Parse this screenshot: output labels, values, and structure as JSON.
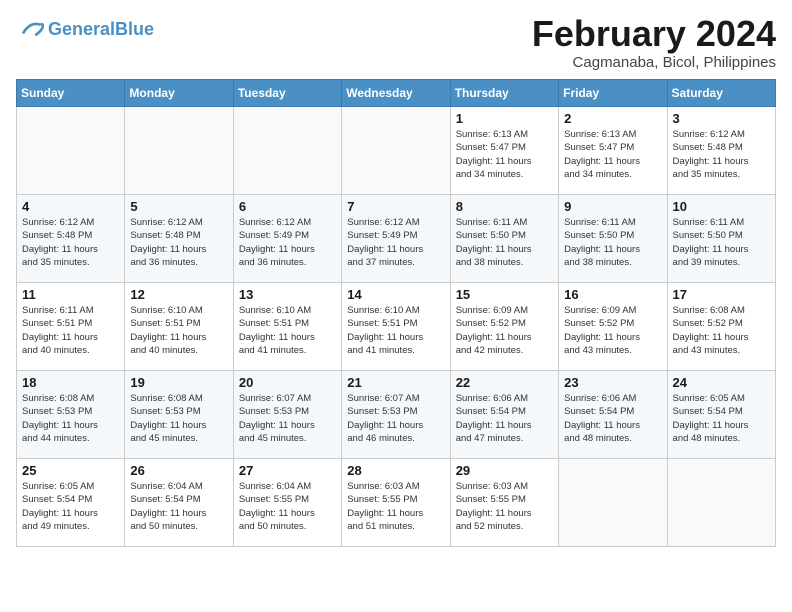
{
  "header": {
    "logo_general": "General",
    "logo_blue": "Blue",
    "month_title": "February 2024",
    "location": "Cagmanaba, Bicol, Philippines"
  },
  "weekdays": [
    "Sunday",
    "Monday",
    "Tuesday",
    "Wednesday",
    "Thursday",
    "Friday",
    "Saturday"
  ],
  "weeks": [
    [
      {
        "day": "",
        "info": ""
      },
      {
        "day": "",
        "info": ""
      },
      {
        "day": "",
        "info": ""
      },
      {
        "day": "",
        "info": ""
      },
      {
        "day": "1",
        "info": "Sunrise: 6:13 AM\nSunset: 5:47 PM\nDaylight: 11 hours\nand 34 minutes."
      },
      {
        "day": "2",
        "info": "Sunrise: 6:13 AM\nSunset: 5:47 PM\nDaylight: 11 hours\nand 34 minutes."
      },
      {
        "day": "3",
        "info": "Sunrise: 6:12 AM\nSunset: 5:48 PM\nDaylight: 11 hours\nand 35 minutes."
      }
    ],
    [
      {
        "day": "4",
        "info": "Sunrise: 6:12 AM\nSunset: 5:48 PM\nDaylight: 11 hours\nand 35 minutes."
      },
      {
        "day": "5",
        "info": "Sunrise: 6:12 AM\nSunset: 5:48 PM\nDaylight: 11 hours\nand 36 minutes."
      },
      {
        "day": "6",
        "info": "Sunrise: 6:12 AM\nSunset: 5:49 PM\nDaylight: 11 hours\nand 36 minutes."
      },
      {
        "day": "7",
        "info": "Sunrise: 6:12 AM\nSunset: 5:49 PM\nDaylight: 11 hours\nand 37 minutes."
      },
      {
        "day": "8",
        "info": "Sunrise: 6:11 AM\nSunset: 5:50 PM\nDaylight: 11 hours\nand 38 minutes."
      },
      {
        "day": "9",
        "info": "Sunrise: 6:11 AM\nSunset: 5:50 PM\nDaylight: 11 hours\nand 38 minutes."
      },
      {
        "day": "10",
        "info": "Sunrise: 6:11 AM\nSunset: 5:50 PM\nDaylight: 11 hours\nand 39 minutes."
      }
    ],
    [
      {
        "day": "11",
        "info": "Sunrise: 6:11 AM\nSunset: 5:51 PM\nDaylight: 11 hours\nand 40 minutes."
      },
      {
        "day": "12",
        "info": "Sunrise: 6:10 AM\nSunset: 5:51 PM\nDaylight: 11 hours\nand 40 minutes."
      },
      {
        "day": "13",
        "info": "Sunrise: 6:10 AM\nSunset: 5:51 PM\nDaylight: 11 hours\nand 41 minutes."
      },
      {
        "day": "14",
        "info": "Sunrise: 6:10 AM\nSunset: 5:51 PM\nDaylight: 11 hours\nand 41 minutes."
      },
      {
        "day": "15",
        "info": "Sunrise: 6:09 AM\nSunset: 5:52 PM\nDaylight: 11 hours\nand 42 minutes."
      },
      {
        "day": "16",
        "info": "Sunrise: 6:09 AM\nSunset: 5:52 PM\nDaylight: 11 hours\nand 43 minutes."
      },
      {
        "day": "17",
        "info": "Sunrise: 6:08 AM\nSunset: 5:52 PM\nDaylight: 11 hours\nand 43 minutes."
      }
    ],
    [
      {
        "day": "18",
        "info": "Sunrise: 6:08 AM\nSunset: 5:53 PM\nDaylight: 11 hours\nand 44 minutes."
      },
      {
        "day": "19",
        "info": "Sunrise: 6:08 AM\nSunset: 5:53 PM\nDaylight: 11 hours\nand 45 minutes."
      },
      {
        "day": "20",
        "info": "Sunrise: 6:07 AM\nSunset: 5:53 PM\nDaylight: 11 hours\nand 45 minutes."
      },
      {
        "day": "21",
        "info": "Sunrise: 6:07 AM\nSunset: 5:53 PM\nDaylight: 11 hours\nand 46 minutes."
      },
      {
        "day": "22",
        "info": "Sunrise: 6:06 AM\nSunset: 5:54 PM\nDaylight: 11 hours\nand 47 minutes."
      },
      {
        "day": "23",
        "info": "Sunrise: 6:06 AM\nSunset: 5:54 PM\nDaylight: 11 hours\nand 48 minutes."
      },
      {
        "day": "24",
        "info": "Sunrise: 6:05 AM\nSunset: 5:54 PM\nDaylight: 11 hours\nand 48 minutes."
      }
    ],
    [
      {
        "day": "25",
        "info": "Sunrise: 6:05 AM\nSunset: 5:54 PM\nDaylight: 11 hours\nand 49 minutes."
      },
      {
        "day": "26",
        "info": "Sunrise: 6:04 AM\nSunset: 5:54 PM\nDaylight: 11 hours\nand 50 minutes."
      },
      {
        "day": "27",
        "info": "Sunrise: 6:04 AM\nSunset: 5:55 PM\nDaylight: 11 hours\nand 50 minutes."
      },
      {
        "day": "28",
        "info": "Sunrise: 6:03 AM\nSunset: 5:55 PM\nDaylight: 11 hours\nand 51 minutes."
      },
      {
        "day": "29",
        "info": "Sunrise: 6:03 AM\nSunset: 5:55 PM\nDaylight: 11 hours\nand 52 minutes."
      },
      {
        "day": "",
        "info": ""
      },
      {
        "day": "",
        "info": ""
      }
    ]
  ]
}
